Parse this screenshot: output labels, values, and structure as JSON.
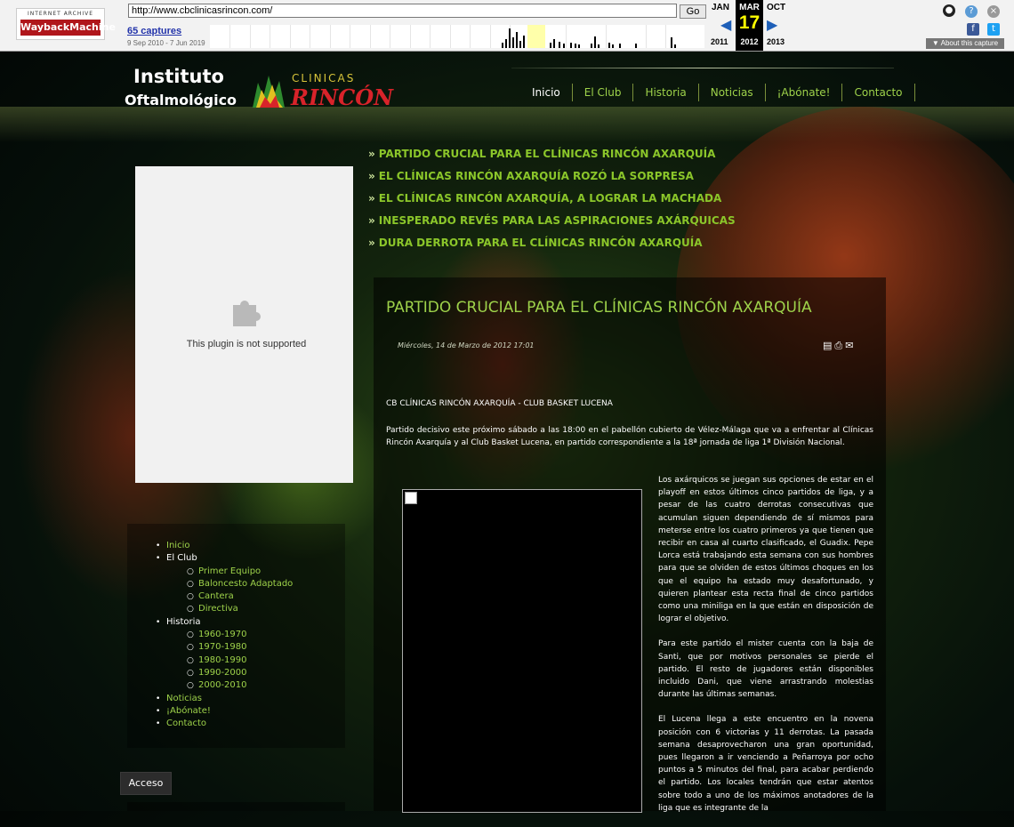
{
  "wayback": {
    "logo_top": "INTERNET ARCHIVE",
    "logo_main": "WaybackMachine",
    "url": "http://www.cbclinicasrincon.com/",
    "go_label": "Go",
    "captures": "65 captures",
    "range": "9 Sep 2010 - 7 Jun 2019",
    "prev_month": "JAN",
    "cur_month": "MAR",
    "next_month": "OCT",
    "day": "17",
    "prev_year": "2011",
    "cur_year": "2012",
    "next_year": "2013",
    "about": "About this capture"
  },
  "header": {
    "logo1_line1": "Instituto",
    "logo1_line2": "Oftalmológico",
    "logo2_line1": "CLINICAS",
    "logo2_line2": "RINCÓN"
  },
  "nav": {
    "items": [
      "Inicio",
      "El Club",
      "Historia",
      "Noticias",
      "¡Abónate!",
      "Contacto"
    ]
  },
  "headlines": [
    "PARTIDO CRUCIAL PARA EL CLÍNICAS RINCÓN AXARQUÍA",
    "EL CLÍNICAS RINCÓN AXARQUÍA ROZÓ LA SORPRESA",
    "EL CLÍNICAS RINCÓN AXARQUÍA, A LOGRAR LA MACHADA",
    "INESPERADO REVÉS PARA LAS ASPIRACIONES AXÁRQUICAS",
    "DURA DERROTA PARA EL CLÍNICAS RINCÓN AXARQUÍA"
  ],
  "plugin": {
    "text": "This plugin is not supported"
  },
  "menu": {
    "inicio": "Inicio",
    "el_club": "El Club",
    "club_items": [
      "Primer Equipo",
      "Baloncesto Adaptado",
      "Cantera",
      "Directiva"
    ],
    "historia": "Historia",
    "historia_items": [
      "1960-1970",
      "1970-1980",
      "1980-1990",
      "1990-2000",
      "2000-2010"
    ],
    "noticias": "Noticias",
    "abonate": "¡Abónate!",
    "contacto": "Contacto",
    "acceso": "Acceso"
  },
  "article": {
    "title": "PARTIDO CRUCIAL PARA EL CLÍNICAS RINCÓN AXARQUÍA",
    "date": "Miércoles, 14 de Marzo de 2012 17:01",
    "subtitle": "CB CLÍNICAS RINCÓN AXARQUÍA - CLUB BASKET LUCENA",
    "intro": "Partido decisivo este próximo sábado a las 18:00 en el pabellón cubierto de Vélez-Málaga que va a enfrentar al Clínicas Rincón Axarquía y al Club Basket Lucena, en partido correspondiente a la 18ª jornada de liga 1ª División Nacional.",
    "p2": "Los axárquicos se juegan sus opciones de estar en el playoff en estos últimos cinco partidos de liga, y a pesar de las cuatro derrotas consecutivas que acumulan siguen dependiendo de sí mismos para meterse entre los cuatro primeros ya que tienen que recibir en casa al cuarto clasificado, el Guadix. Pepe Lorca está trabajando esta semana con sus hombres para que se olviden de estos últimos choques en  los que el equipo ha estado muy desafortunado, y quieren plantear esta recta final de cinco partidos como una miniliga en la que están en disposición de lograr el objetivo.",
    "p3": "Para este partido el mister cuenta con la baja de Santi, que por motivos personales se pierde el partido. El resto de jugadores están disponibles incluido Dani, que viene arrastrando molestias durante las últimas semanas.",
    "p4": "El Lucena llega a este encuentro en la novena posición con 6 victorias y 11 derrotas. La pasada semana desaprovecharon una gran oportunidad, pues llegaron a ir venciendo a Peñarroya por ocho puntos a 5 minutos del final, para acabar perdiendo el partido. Los locales tendrán que estar atentos sobre todo a uno de los máximos anotadores de la liga que es integrante de la"
  }
}
